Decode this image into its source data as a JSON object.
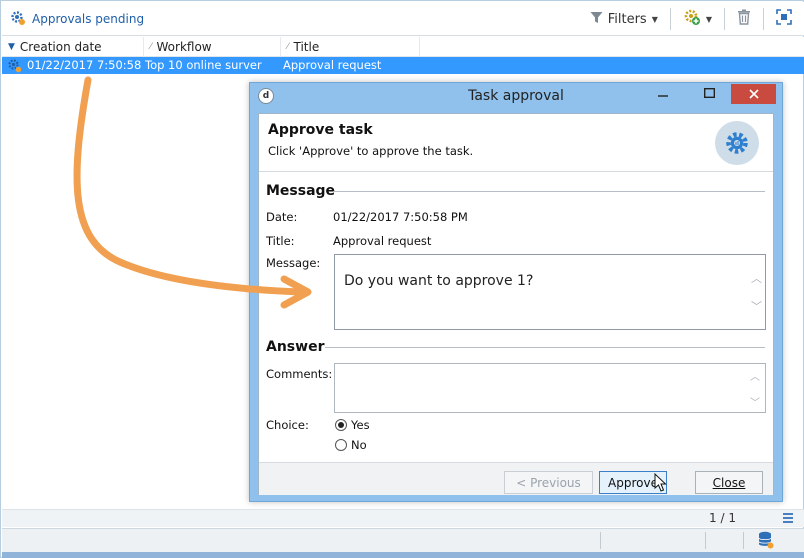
{
  "toolbar": {
    "title": "Approvals pending",
    "filters_label": "Filters"
  },
  "list": {
    "columns": [
      "Creation date",
      "Workflow",
      "Title"
    ],
    "rows": [
      {
        "creation_date": "01/22/2017 7:50:58 ...",
        "workflow": "Top 10 online surver",
        "title": "Approval request"
      }
    ],
    "pager": "1 / 1"
  },
  "dialog": {
    "window_title": "Task approval",
    "header_title": "Approve task",
    "header_subtitle": "Click 'Approve' to approve the task.",
    "message_section": "Message",
    "date_label": "Date:",
    "date_value": "01/22/2017 7:50:58 PM",
    "title_label": "Title:",
    "title_value": "Approval request",
    "message_label": "Message:",
    "message_value": "Do you want to approve 1?",
    "answer_section": "Answer",
    "comments_label": "Comments:",
    "choice_label": "Choice:",
    "choices": [
      {
        "label": "Yes",
        "selected": true
      },
      {
        "label": "No",
        "selected": false
      }
    ],
    "buttons": {
      "previous": "Previous",
      "approve": "Approve",
      "close": "Close"
    }
  },
  "colors": {
    "accent": "#1f5fa8",
    "selection": "#3399ff",
    "dialog_frame": "#8fc1ec",
    "arrow": "#f0a050"
  }
}
